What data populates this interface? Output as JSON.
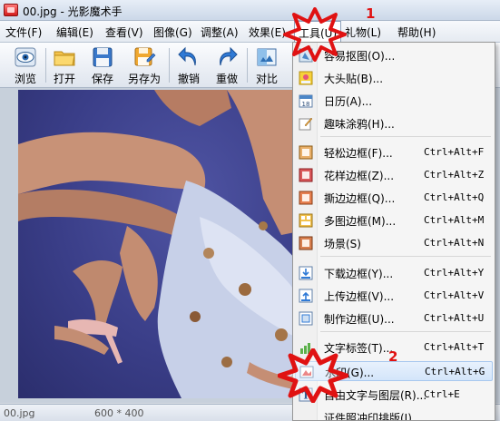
{
  "window": {
    "title": "00.jpg - 光影魔术手"
  },
  "menubar": {
    "items": [
      {
        "label": "文件(F)"
      },
      {
        "label": "编辑(E)"
      },
      {
        "label": "查看(V)"
      },
      {
        "label": "图像(G)"
      },
      {
        "label": "调整(A)"
      },
      {
        "label": "效果(E)"
      },
      {
        "label": "工具(U)"
      },
      {
        "label": "礼物(L)"
      },
      {
        "label": "帮助(H)"
      }
    ]
  },
  "toolbar": {
    "buttons": [
      {
        "label": "浏览",
        "icon": "eye-icon"
      },
      {
        "label": "打开",
        "icon": "folder-icon"
      },
      {
        "label": "保存",
        "icon": "floppy-icon"
      },
      {
        "label": "另存为",
        "icon": "save-as-icon"
      },
      {
        "label": "撤销",
        "icon": "undo-icon"
      },
      {
        "label": "重做",
        "icon": "redo-icon"
      },
      {
        "label": "对比",
        "icon": "compare-icon"
      }
    ]
  },
  "statusbar": {
    "filename": "00.jpg",
    "dimensions": "600 * 400"
  },
  "tools_menu": {
    "items": [
      {
        "label": "容易抠图(O)...",
        "shortcut": "",
        "icon": "cutout-icon"
      },
      {
        "label": "大头贴(B)...",
        "shortcut": "",
        "icon": "photo-sticker-icon"
      },
      {
        "label": "日历(A)...",
        "shortcut": "",
        "icon": "calendar-icon"
      },
      {
        "label": "趣味涂鸦(H)...",
        "shortcut": "",
        "icon": "doodle-icon"
      },
      {
        "label": "轻松边框(F)...",
        "shortcut": "Ctrl+Alt+F",
        "icon": "frame-icon"
      },
      {
        "label": "花样边框(Z)...",
        "shortcut": "Ctrl+Alt+Z",
        "icon": "frame-icon"
      },
      {
        "label": "撕边边框(Q)...",
        "shortcut": "Ctrl+Alt+Q",
        "icon": "frame-icon"
      },
      {
        "label": "多图边框(M)...",
        "shortcut": "Ctrl+Alt+M",
        "icon": "frame-icon"
      },
      {
        "label": "场景(S)",
        "shortcut": "Ctrl+Alt+N",
        "icon": "scene-icon"
      },
      {
        "label": "下载边框(Y)...",
        "shortcut": "Ctrl+Alt+Y",
        "icon": "download-icon"
      },
      {
        "label": "上传边框(V)...",
        "shortcut": "Ctrl+Alt+V",
        "icon": "upload-icon"
      },
      {
        "label": "制作边框(U)...",
        "shortcut": "Ctrl+Alt+U",
        "icon": "make-frame-icon"
      },
      {
        "label": "文字标签(T)...",
        "shortcut": "Ctrl+Alt+T",
        "icon": "text-label-icon"
      },
      {
        "label": "水印(G)...",
        "shortcut": "Ctrl+Alt+G",
        "icon": "watermark-icon"
      },
      {
        "label": "自由文字与图层(R)...",
        "shortcut": "Ctrl+E",
        "icon": "text-layer-icon"
      },
      {
        "label": "证件照冲印排版(I)...",
        "shortcut": "",
        "icon": ""
      }
    ]
  },
  "annotations": {
    "step1": "1",
    "step2": "2"
  },
  "colors": {
    "highlight": "#d3e5fa",
    "annotation": "#e01212"
  }
}
